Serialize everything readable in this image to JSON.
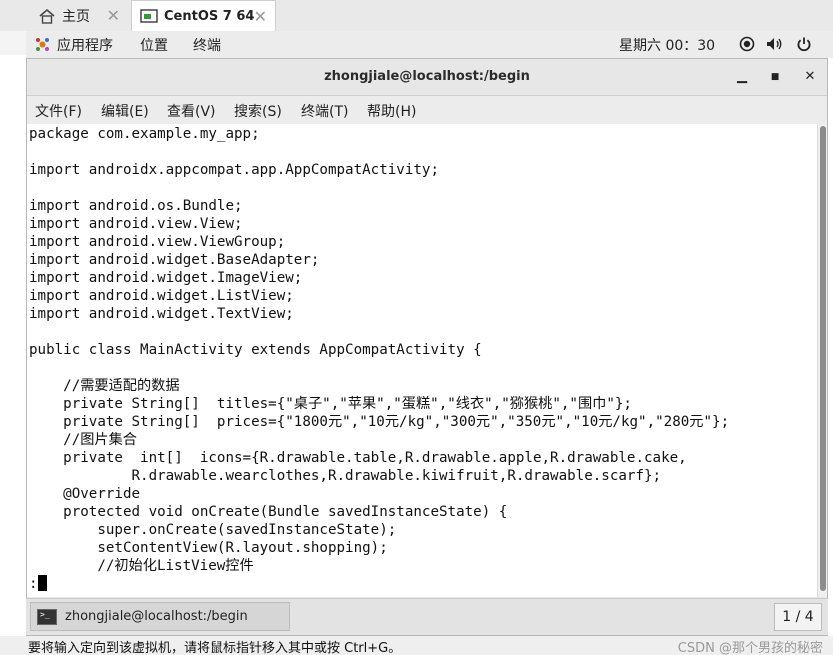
{
  "vm_tabs": [
    {
      "label": "主页",
      "icon": "home-icon"
    },
    {
      "label": "CentOS 7 64",
      "icon": "vm-icon"
    }
  ],
  "gnome_bar": {
    "applications": "应用程序",
    "places": "位置",
    "terminal": "终端",
    "clock": "星期六 00：30"
  },
  "window": {
    "title": "zhongjiale@localhost:/begin",
    "menus": [
      "文件(F)",
      "编辑(E)",
      "查看(V)",
      "搜索(S)",
      "终端(T)",
      "帮助(H)"
    ]
  },
  "code_lines": [
    "package com.example.my_app;",
    "",
    "import androidx.appcompat.app.AppCompatActivity;",
    "",
    "import android.os.Bundle;",
    "import android.view.View;",
    "import android.view.ViewGroup;",
    "import android.widget.BaseAdapter;",
    "import android.widget.ImageView;",
    "import android.widget.ListView;",
    "import android.widget.TextView;",
    "",
    "public class MainActivity extends AppCompatActivity {",
    "",
    "    //需要适配的数据",
    "    private String[]  titles={\"桌子\",\"苹果\",\"蛋糕\",\"线衣\",\"猕猴桃\",\"围巾\"};",
    "    private String[]  prices={\"1800元\",\"10元/kg\",\"300元\",\"350元\",\"10元/kg\",\"280元\"};",
    "    //图片集合",
    "    private  int[]  icons={R.drawable.table,R.drawable.apple,R.drawable.cake,",
    "            R.drawable.wearclothes,R.drawable.kiwifruit,R.drawable.scarf};",
    "    @Override",
    "    protected void onCreate(Bundle savedInstanceState) {",
    "        super.onCreate(savedInstanceState);",
    "        setContentView(R.layout.shopping);",
    "        //初始化ListView控件"
  ],
  "prompt": ":",
  "taskbar": {
    "task_label": "zhongjiale@localhost:/begin",
    "pager": "1 / 4"
  },
  "status": {
    "message": "要将输入定向到该虚拟机，请将鼠标指针移入其中或按 Ctrl+G。",
    "watermark": "CSDN @那个男孩的秘密"
  }
}
